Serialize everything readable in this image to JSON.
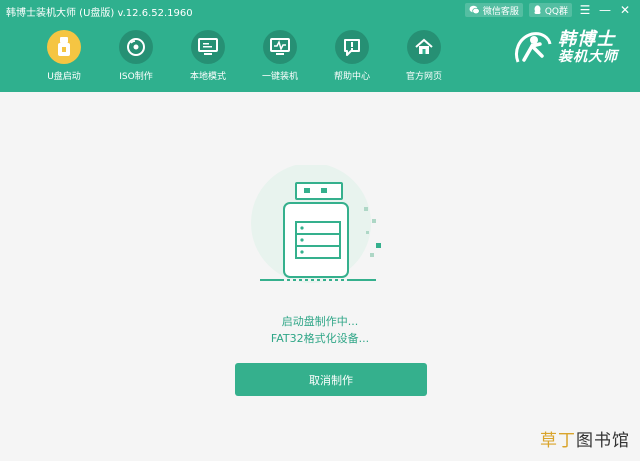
{
  "window": {
    "title": "韩博士装机大师 (U盘版) v.12.6.52.1960",
    "wechat_label": "微信客服",
    "qq_label": "QQ群",
    "menu_glyph": "☰",
    "minimize_glyph": "—",
    "close_glyph": "✕"
  },
  "nav": {
    "items": [
      {
        "label": "U盘启动",
        "icon": "usb-icon",
        "active": true
      },
      {
        "label": "ISO制作",
        "icon": "disc-icon"
      },
      {
        "label": "本地模式",
        "icon": "monitor-icon"
      },
      {
        "label": "一键装机",
        "icon": "pulse-monitor-icon"
      },
      {
        "label": "帮助中心",
        "icon": "help-icon"
      },
      {
        "label": "官方网页",
        "icon": "home-icon"
      }
    ]
  },
  "brand": {
    "line1": "韩博士",
    "line2": "装机大师"
  },
  "status": {
    "line1": "启动盘制作中...",
    "line2": "FAT32格式化设备..."
  },
  "actions": {
    "cancel_label": "取消制作"
  },
  "watermark": {
    "part1": "草丁",
    "part2": "图书馆"
  },
  "colors": {
    "primary": "#2fb08e",
    "active_nav": "#f5c542",
    "text_accent": "#2fa687"
  }
}
